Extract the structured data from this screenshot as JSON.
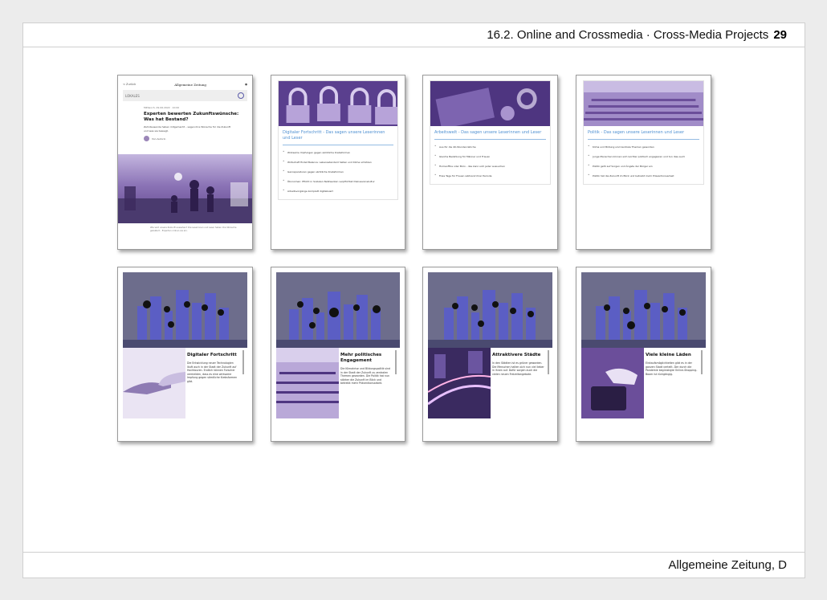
{
  "header": {
    "title": "16.2. Online and Crossmedia · Cross-Media Projects",
    "page_number": "29"
  },
  "footer": {
    "source": "Allgemeine Zeitung, D"
  },
  "article": {
    "top_left": "< Zurück",
    "logo": "Allgemeine Zeitung",
    "nav_label": "LOKALES",
    "meta": "Mittwoch, 29.06.2022 · 10:00",
    "title": "Experten bewerten Zukunftswünsche: Was hat Bestand?",
    "lead": "Zehntausende haben mitgemacht – sagen ihre Wünsche für die Zukunft und was sie bewegt.",
    "author": "Von Autorin",
    "caption": "Wie wird unsere Zukunft aussehen? Die Leserinnen und Leser haben ihre Wünsche geäußert – Experten ordnen sie ein."
  },
  "lists": [
    {
      "title": "Digitaler Fortschritt - Das sagen unsere Leserinnen und Leser",
      "items": [
        "Wirksame Impfungen gegen sämtliche Krebsformen",
        "Wirtschaft findet Balance: Lebensstandard halten und Klima schützen",
        "Genreparaturen gegen sämtliche Krebsformen",
        "Ökonomen: Pflicht in Sozialen Netzwerken verpflichtet Diskussionskultur",
        "Arbeitsvorgänge komplett digitalisiert"
      ]
    },
    {
      "title": "Arbeitswelt - Das sagen unsere Leserinnen und Leser",
      "items": [
        "Aus für die 40-Stunden-Woche",
        "Gleiche Bezahlung für Männer und Frauen",
        "Homeoffice oder Büro - das kann sich jeder aussuchen",
        "Freie Tage für Frauen während ihrer Periode"
      ]
    },
    {
      "title": "Politik - Das sagen unsere Leserinnen und Leser",
      "items": [
        "Klima und Bildung sind zentrale Themen geworden",
        "Junge Menschen können sich leichter politisch engagieren und tun dies auch",
        "Politik geht auf Sorgen und Ängste der Bürger ein",
        "Politik hat die Zukunft im Blick und betreibt mehr Präventionsarbeit"
      ]
    }
  ],
  "stories": [
    {
      "title": "Digitaler Fortschritt",
      "body": "Die Entwicklung neuer Technologien läuft auch in der Stadt der Zukunft auf Hochtouren. Endlich können Forscher vermelden, dass es eine wirksame Impfung gegen sämtliche Krebsformen gibt."
    },
    {
      "title": "Mehr politisches Engagement",
      "body": "Die Klimakrise und Bildungspolitik sind in der Stadt der Zukunft zu zentralen Themen geworden. Die Politik hat nun stärker die Zukunft im Blick und betreibt mehr Präventionsarbeit."
    },
    {
      "title": "Attraktivere Städte",
      "body": "In den Städten ist es grüner geworden. Die Menschen halten sich nun viel lieber in ihnen auf. Dafür sorgen auch die vielen neuen Freizeitangebote."
    },
    {
      "title": "Viele kleine Läden",
      "body": "Einkaufsmöglichkeiten gibt es in der ganzen Stadt verteilt. Der durch die Pandemie begünstigte Online-Shopping-Boom ist rückgängig."
    }
  ],
  "colors": {
    "accent_blue": "#4d8fd1",
    "purple": "#6b4e9a",
    "border": "#9a9a9a"
  }
}
